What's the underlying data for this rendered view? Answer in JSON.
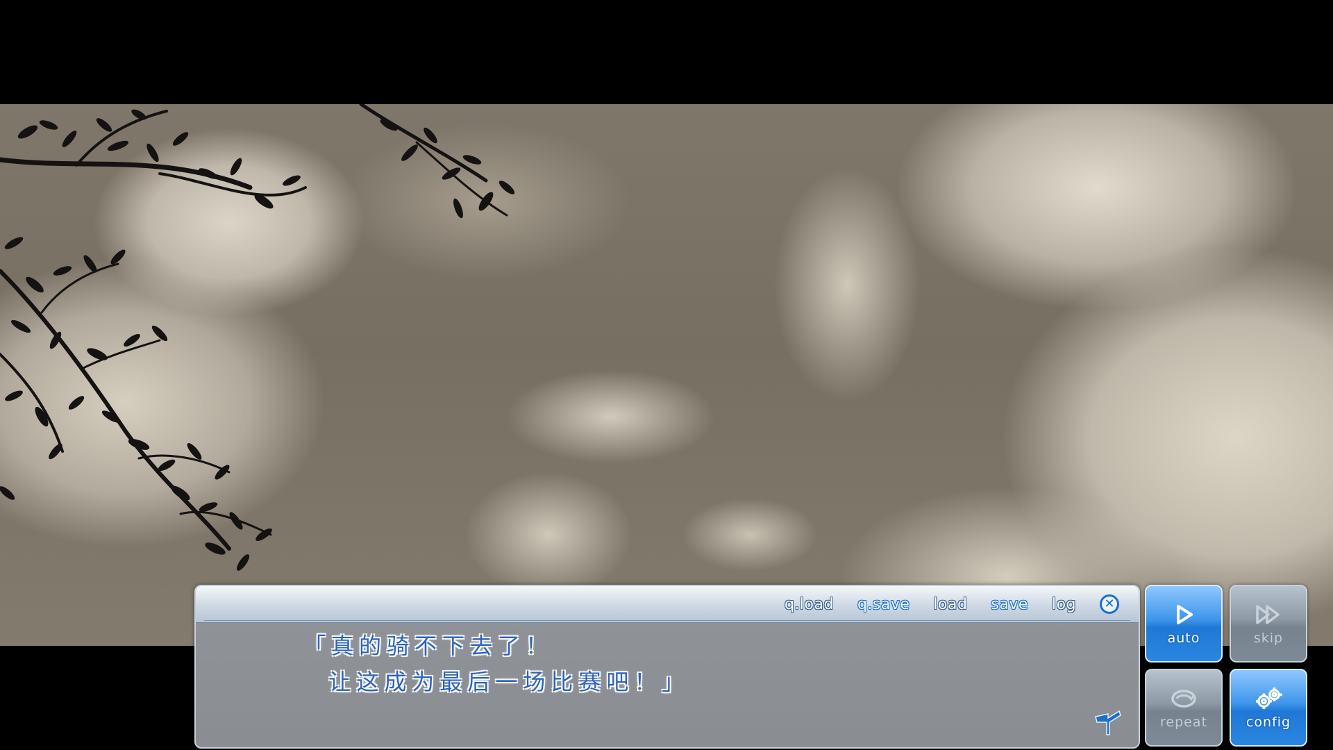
{
  "menu": {
    "qload_label": "q.load",
    "qsave_label": "q.save",
    "load_label": "load",
    "save_label": "save",
    "log_label": "log",
    "close_icon": "close-icon"
  },
  "dialogue": {
    "text": "「真的骑不下去了！\n  让这成为最后一场比赛吧！」",
    "next_icon": "page-advance-icon"
  },
  "side_buttons": {
    "auto": {
      "label": "auto",
      "icon": "play-icon",
      "state": "on"
    },
    "skip": {
      "label": "skip",
      "icon": "fast-forward-icon",
      "state": "off"
    },
    "repeat": {
      "label": "repeat",
      "icon": "repeat-icon",
      "state": "off"
    },
    "config": {
      "label": "config",
      "icon": "gear-icon",
      "state": "on"
    }
  },
  "colors": {
    "accent_blue": "#2a86e0",
    "text_blue": "#2f63b4",
    "scene_tint": "sepia"
  }
}
